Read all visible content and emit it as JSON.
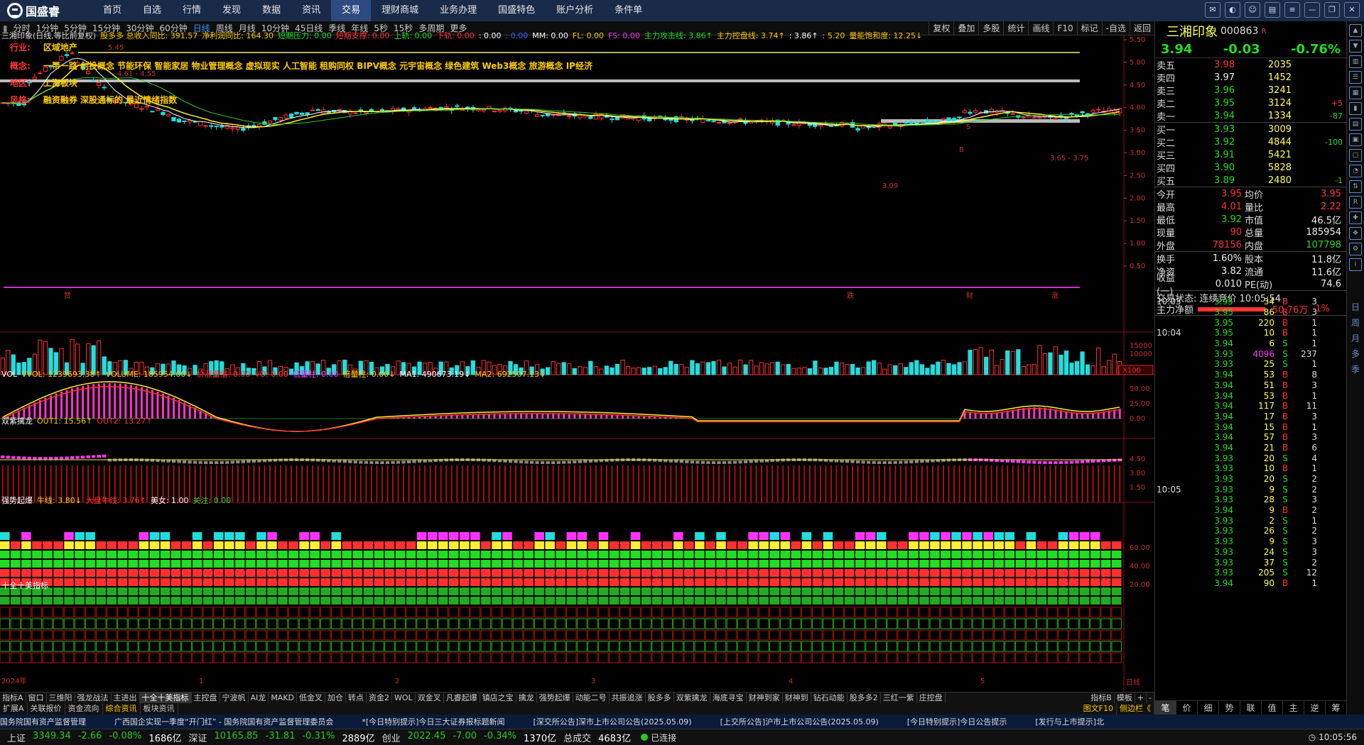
{
  "nav": {
    "logo_text": "国盛睿",
    "items": [
      "首页",
      "自选",
      "行情",
      "发现",
      "数据",
      "资讯",
      "交易",
      "理财商城",
      "业务办理",
      "国盛特色",
      "账户分析",
      "条件单"
    ],
    "active_index": 6
  },
  "periods": {
    "items": [
      "分时",
      "1分钟",
      "5分钟",
      "15分钟",
      "30分钟",
      "60分钟",
      "日线",
      "周线",
      "月线",
      "10分钟",
      "45日线",
      "季线",
      "年线",
      "5秒",
      "15秒",
      "多周期",
      "更多"
    ],
    "active_index": 6,
    "right_buttons": [
      "复权",
      "叠加",
      "多股",
      "统计",
      "画线",
      "F10",
      "标记",
      "-自选",
      "返回"
    ]
  },
  "main_panel": {
    "header": [
      {
        "text": "三湘印象(日线,等比前复权)",
        "color": "#dddddd"
      },
      {
        "text": "股多多 总收入同比: 391.57",
        "color": "#ffcc00"
      },
      {
        "text": "净利润同比: 164.30",
        "color": "#ffcc00"
      },
      {
        "text": "短期压力: 0.00",
        "color": "#22dd22"
      },
      {
        "text": "短期支撑: 0.00",
        "color": "#ff3333"
      },
      {
        "text": "上轨: 0.00",
        "color": "#22dd22"
      },
      {
        "text": "下轨: 0.00",
        "color": "#ff3333"
      },
      {
        "text": ": 0.00",
        "color": "#ffffff"
      },
      {
        "text": ": 0.00",
        "color": "#3366ff"
      },
      {
        "text": "MM: 0.00",
        "color": "#ffffff"
      },
      {
        "text": "FL: 0.00",
        "color": "#ffcc00"
      },
      {
        "text": "FS: 0.00",
        "color": "#ff33ff"
      },
      {
        "text": "主力攻击线: 3.86↑",
        "color": "#22dd22"
      },
      {
        "text": "主力控盘线: 3.74↑",
        "color": "#ffcc00"
      },
      {
        "text": ": 3.86↑",
        "color": "#ffffff"
      },
      {
        "text": ": 5.20",
        "color": "#ffcc00"
      },
      {
        "text": "量能饱和度: 12.25↓",
        "color": "#ffcc00"
      }
    ],
    "info": {
      "industry_label": "行业:",
      "industry": "区域地产",
      "concept_label": "概念:",
      "concept": "一带一路 创投概念 节能环保 智能家居 物业管理概念 虚拟现实 人工智能 租购同权 BIPV概念 元宇宙概念 绿色建筑 Web3概念 旅游概念 IP经济",
      "region_label": "地区:",
      "region": "上海板块",
      "style_label": "风格:",
      "style": "融资融券 深股通标的 最近情绪指数"
    },
    "yaxis": [
      "5.50",
      "5.00",
      "4.50",
      "4.00",
      "3.50",
      "3.00",
      "2.50",
      "2.00",
      "1.50",
      "1.00",
      "0.50"
    ],
    "annotations": {
      "high": "5.45",
      "range1": "4.61 - 4.55",
      "low": "3.09",
      "range2": "3.65 - 3.75"
    },
    "markers": {
      "m1": "赞",
      "m2": "跌",
      "m3": "财",
      "m4": "涨",
      "s": "S",
      "b": "B"
    }
  },
  "vol_panel": {
    "header": [
      {
        "text": "VOL",
        "color": "#ffffff"
      },
      {
        "text": "VVOL: 1239693.38↑",
        "color": "#ffcc00"
      },
      {
        "text": "VOLUME: 185954.00↓",
        "color": "#ffcc00"
      },
      {
        "text": "价涨量缩: 0.00",
        "color": "#ff3333"
      },
      {
        "text": "VO: 0.00",
        "color": "#ff3333"
      },
      {
        "text": "低量柱: 0.00",
        "color": "#ff33ff"
      },
      {
        "text": "倍量柱: 0.00↓",
        "color": "#ffcc00"
      },
      {
        "text": "MA1: 490673.19↓",
        "color": "#ffffff"
      },
      {
        "text": "MA2: 692507.13↓",
        "color": "#ffcc00"
      }
    ],
    "yaxis": [
      "15000",
      "10000"
    ],
    "unit": "X100"
  },
  "macd_panel": {
    "header": [
      {
        "text": "双紫擒龙",
        "color": "#ffffff"
      },
      {
        "text": "OUT1: 15.56↑",
        "color": "#ffcc00"
      },
      {
        "text": "OUT2: 13.27↑",
        "color": "#ff3333"
      }
    ],
    "yaxis": [
      "50.00",
      "25.00",
      "0.00"
    ]
  },
  "strong_panel": {
    "header": [
      {
        "text": "强势起爆",
        "color": "#ffffff"
      },
      {
        "text": "牛线: 3.80↓",
        "color": "#ffcc00"
      },
      {
        "text": "大盘牛线: 3.76↑",
        "color": "#ff3333"
      },
      {
        "text": "美女: 1.00",
        "color": "#ffffff"
      },
      {
        "text": "关注: 0.00",
        "color": "#22dd22"
      }
    ],
    "yaxis": [
      "4.50",
      "3.00",
      "1.50"
    ]
  },
  "ten_panel": {
    "header": [
      {
        "text": "十全十美指标",
        "color": "#ffffff"
      }
    ],
    "yaxis": [
      "60.00",
      "40.00",
      "20.00"
    ],
    "xaxis": [
      "2024年",
      "1",
      "2",
      "3",
      "4",
      "5"
    ]
  },
  "indicator_tabs": [
    "指标A",
    "窗口",
    "三维阳",
    "强龙战法",
    "主进出",
    "十全十美指标",
    "主控盘",
    "宁波帆",
    "AI龙",
    "MAKD",
    "低金叉",
    "加仓",
    "转点",
    "资金2",
    "WOL",
    "双金叉",
    "凡睿起爆",
    "镇店之宝",
    "擒龙",
    "强势起爆",
    "动能二号",
    "共振追涨",
    "股多多",
    "双紫擒龙",
    "海底寻宝",
    "财神到家",
    "财神到",
    "钻石动能",
    "股多多2",
    "三红一紫",
    "庄控盘"
  ],
  "indicator_tabs_right": [
    "指标B",
    "模板",
    "+",
    "-"
  ],
  "indicator_active_index": 5,
  "bottom_tabs": [
    "扩展A",
    "关联报价",
    "资金流向",
    "综合资讯",
    "板块资讯"
  ],
  "bottom_tabs_active_index": 3,
  "bottom_right_links": [
    "图文F10",
    "侧边栏《"
  ],
  "period_label": "日线",
  "news": [
    "国务院国有资产监督管理",
    "广西国企实现一季度“开门红” - 国务院国有资产监督管理委员会",
    "*[今日特别提示]今日三大证券报标题新闻",
    "[深交所公告]深市上市公司公告(2025.05.09)",
    "[上交所公告]沪市上市公司公告(2025.05.09)",
    "[今日特别提示]今日公告提示",
    "[发行与上市提示]北"
  ],
  "status": {
    "sh_label": "上证",
    "sh": "3349.34",
    "sh_chg": "-2.66",
    "sh_pct": "-0.08%",
    "sh_amt": "1686亿",
    "sz_label": "深证",
    "sz": "10165.85",
    "sz_chg": "-31.81",
    "sz_pct": "-0.31%",
    "sz_amt": "2889亿",
    "cy_label": "创业",
    "cy": "2022.45",
    "cy_chg": "-7.00",
    "cy_pct": "-0.34%",
    "cy_amt": "1370亿",
    "total_label": "总成交",
    "total": "4683亿",
    "conn": "已连接",
    "time": "10:05:56"
  },
  "quote": {
    "name": "三湘印象",
    "code": "000863",
    "flag": "R",
    "price": "3.94",
    "change": "-0.03",
    "pct": "-0.76%",
    "asks": [
      {
        "label": "卖五",
        "price": "3.98",
        "vol": "2035",
        "chg": ""
      },
      {
        "label": "卖四",
        "price": "3.97",
        "vol": "1452",
        "chg": ""
      },
      {
        "label": "卖三",
        "price": "3.96",
        "vol": "3241",
        "chg": ""
      },
      {
        "label": "卖二",
        "price": "3.95",
        "vol": "3124",
        "chg": "+5"
      },
      {
        "label": "卖一",
        "price": "3.94",
        "vol": "1334",
        "chg": "-87"
      }
    ],
    "bids": [
      {
        "label": "买一",
        "price": "3.93",
        "vol": "3009",
        "chg": ""
      },
      {
        "label": "买二",
        "price": "3.92",
        "vol": "4844",
        "chg": "-100"
      },
      {
        "label": "买三",
        "price": "3.91",
        "vol": "5421",
        "chg": ""
      },
      {
        "label": "买四",
        "price": "3.90",
        "vol": "5828",
        "chg": ""
      },
      {
        "label": "买五",
        "price": "3.89",
        "vol": "2480",
        "chg": "-1"
      }
    ],
    "stats": [
      {
        "l1": "今开",
        "v1": "3.95",
        "c1": "red",
        "l2": "均价",
        "v2": "3.95",
        "c2": "red"
      },
      {
        "l1": "最高",
        "v1": "4.01",
        "c1": "red",
        "l2": "量比",
        "v2": "2.22",
        "c2": "red"
      },
      {
        "l1": "最低",
        "v1": "3.92",
        "c1": "green",
        "l2": "市值",
        "v2": "46.5亿",
        "c2": "white"
      },
      {
        "l1": "现量",
        "v1": "90",
        "c1": "red",
        "l2": "总量",
        "v2": "185954",
        "c2": "white"
      },
      {
        "l1": "外盘",
        "v1": "78156",
        "c1": "red",
        "l2": "内盘",
        "v2": "107798",
        "c2": "green"
      }
    ],
    "stats2": [
      {
        "l1": "换手",
        "v1": "1.60%",
        "c1": "white",
        "l2": "股本",
        "v2": "11.8亿",
        "c2": "white"
      },
      {
        "l1": "净资",
        "v1": "3.82",
        "c1": "white",
        "l2": "流通",
        "v2": "11.6亿",
        "c2": "white"
      },
      {
        "l1": "收益(一)",
        "v1": "0.010",
        "c1": "white",
        "l2": "PE(动)",
        "v2": "74.6",
        "c2": "white"
      }
    ],
    "trade_status": "交易状态: 连续竞价 10:05:54",
    "netflow_label": "主力净额",
    "netflow": "50.76万",
    "netflow_pct": "1%",
    "ticks": [
      [
        "10:03",
        "3.95",
        "34",
        "B",
        "3"
      ],
      [
        "",
        "3.95",
        "86",
        "B",
        "3"
      ],
      [
        "",
        "3.95",
        "220",
        "B",
        "1"
      ],
      [
        "10:04",
        "3.95",
        "10",
        "B",
        "1"
      ],
      [
        "",
        "3.94",
        "6",
        "S",
        "1"
      ],
      [
        "",
        "3.93",
        "4096",
        "S",
        "237"
      ],
      [
        "",
        "3.93",
        "25",
        "S",
        "1"
      ],
      [
        "",
        "3.94",
        "53",
        "B",
        "8"
      ],
      [
        "",
        "3.94",
        "51",
        "B",
        "3"
      ],
      [
        "",
        "3.94",
        "53",
        "B",
        "1"
      ],
      [
        "",
        "3.94",
        "117",
        "B",
        "11"
      ],
      [
        "",
        "3.94",
        "17",
        "B",
        "3"
      ],
      [
        "",
        "3.94",
        "15",
        "B",
        "1"
      ],
      [
        "",
        "3.94",
        "57",
        "B",
        "3"
      ],
      [
        "",
        "3.94",
        "21",
        "B",
        "6"
      ],
      [
        "",
        "3.93",
        "20",
        "S",
        "4"
      ],
      [
        "",
        "3.93",
        "10",
        "B",
        "1"
      ],
      [
        "",
        "3.93",
        "20",
        "S",
        "2"
      ],
      [
        "10:05",
        "3.93",
        "9",
        "S",
        "2"
      ],
      [
        "",
        "3.93",
        "28",
        "S",
        "3"
      ],
      [
        "",
        "3.94",
        "9",
        "B",
        "2"
      ],
      [
        "",
        "3.93",
        "2",
        "S",
        "1"
      ],
      [
        "",
        "3.93",
        "26",
        "S",
        "2"
      ],
      [
        "",
        "3.93",
        "9",
        "S",
        "3"
      ],
      [
        "",
        "3.93",
        "24",
        "S",
        "3"
      ],
      [
        "",
        "3.93",
        "37",
        "S",
        "2"
      ],
      [
        "",
        "3.93",
        "205",
        "S",
        "12"
      ],
      [
        "",
        "3.94",
        "90",
        "B",
        "1"
      ]
    ],
    "tabs": [
      "笔",
      "价",
      "细",
      "势",
      "联",
      "值",
      "主",
      "逆",
      "筹"
    ]
  },
  "side_chars": [
    "日",
    "周",
    "月",
    "多",
    "季"
  ]
}
